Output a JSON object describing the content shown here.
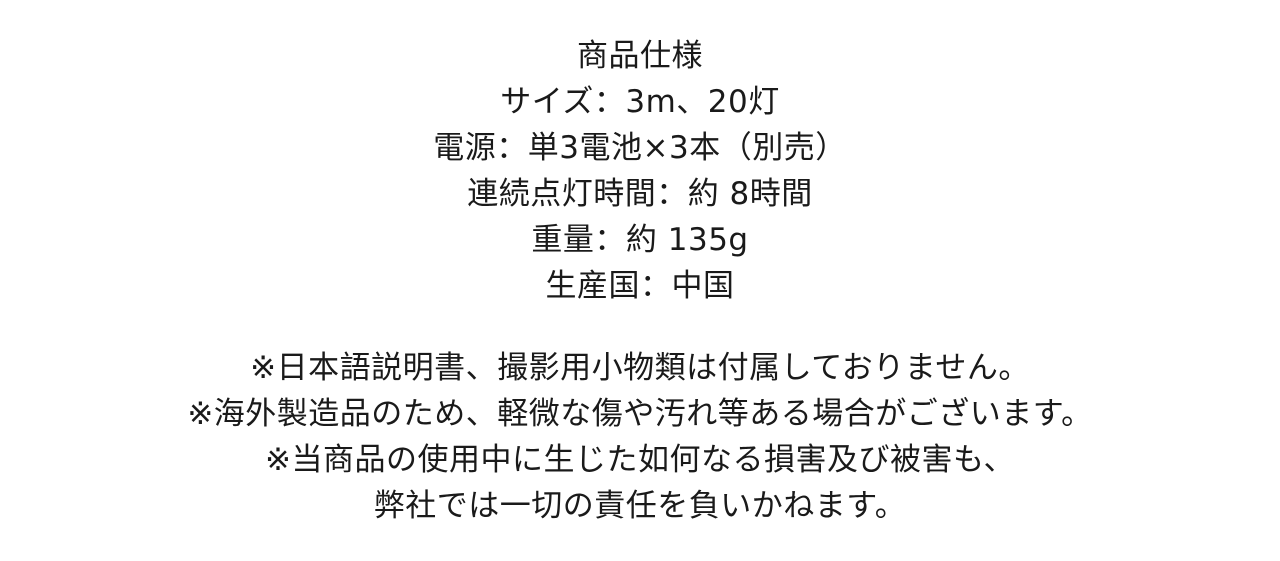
{
  "specs": {
    "heading": "商品仕様",
    "size": "サイズ：3m、20灯",
    "power": "電源：単3電池×3本（別売）",
    "runtime": "連続点灯時間：約 8時間",
    "weight": "重量：約 135g",
    "origin": "生産国：中国"
  },
  "notices": {
    "line1": "※日本語説明書、撮影用小物類は付属しておりません。",
    "line2": "※海外製造品のため、軽微な傷や汚れ等ある場合がございます。",
    "line3": "※当商品の使用中に生じた如何なる損害及び被害も、",
    "line4": "弊社では一切の責任を負いかねます。"
  }
}
